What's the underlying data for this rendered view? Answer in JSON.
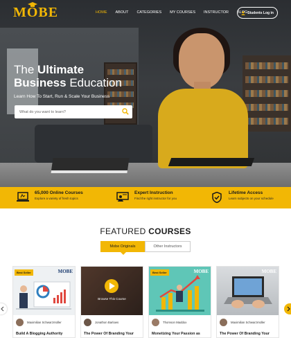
{
  "brand": {
    "logo": "MOBE",
    "accent": "#f2b705"
  },
  "nav": {
    "links": [
      {
        "label": "HOME",
        "active": true
      },
      {
        "label": "ABOUT",
        "active": false
      },
      {
        "label": "CATEGORIES",
        "active": false
      },
      {
        "label": "MY COURSES",
        "active": false
      },
      {
        "label": "INSTRUCTOR",
        "active": false
      },
      {
        "label": "BLOG",
        "active": false
      }
    ],
    "login_label": "Students Log in"
  },
  "hero": {
    "headline_line1_light": "The ",
    "headline_line1_bold": "Ultimate",
    "headline_line2_bold": "Business",
    "headline_line2_light": " Education",
    "tagline": "Learn How To Start, Run & Scale Your Business",
    "search": {
      "placeholder": "What do you want to learn?",
      "value": ""
    }
  },
  "features": [
    {
      "title": "65,000 Online Courses",
      "subtitle": "Explore a variety of fresh topics",
      "icon": "laptop-icon"
    },
    {
      "title": "Expert Instruction",
      "subtitle": "Find the right instructor for you",
      "icon": "instructor-icon"
    },
    {
      "title": "Lifetime Access",
      "subtitle": "Learn subjects on your schedule",
      "icon": "shield-check-icon"
    }
  ],
  "featured": {
    "title_light": "FEATURED ",
    "title_bold": "COURSES",
    "tabs": [
      {
        "label": "Mobe Originals",
        "active": true
      },
      {
        "label": "Other Instructors",
        "active": false
      }
    ]
  },
  "cards": [
    {
      "badge": "Best Seller",
      "logo": "MOBE",
      "author": "Maximilian Schwarzmüller",
      "title": "Build A Blogging Authority",
      "thumb": "presenter-chart"
    },
    {
      "badge": "",
      "logo": "",
      "overlay": "Browse This Course",
      "author": "Jonathon Barlows",
      "title": "The Power Of Branding Your",
      "thumb": "play-video"
    },
    {
      "badge": "Best Seller",
      "logo": "MOBE",
      "author": "Thomson Maddox",
      "title": "Monetizing Your Passion as",
      "thumb": "growth-chart"
    },
    {
      "badge": "",
      "logo": "MOBE",
      "author": "Maximilian Schwarzmüller",
      "title": "The Power Of Branding Your",
      "thumb": "laptop-hands"
    }
  ]
}
